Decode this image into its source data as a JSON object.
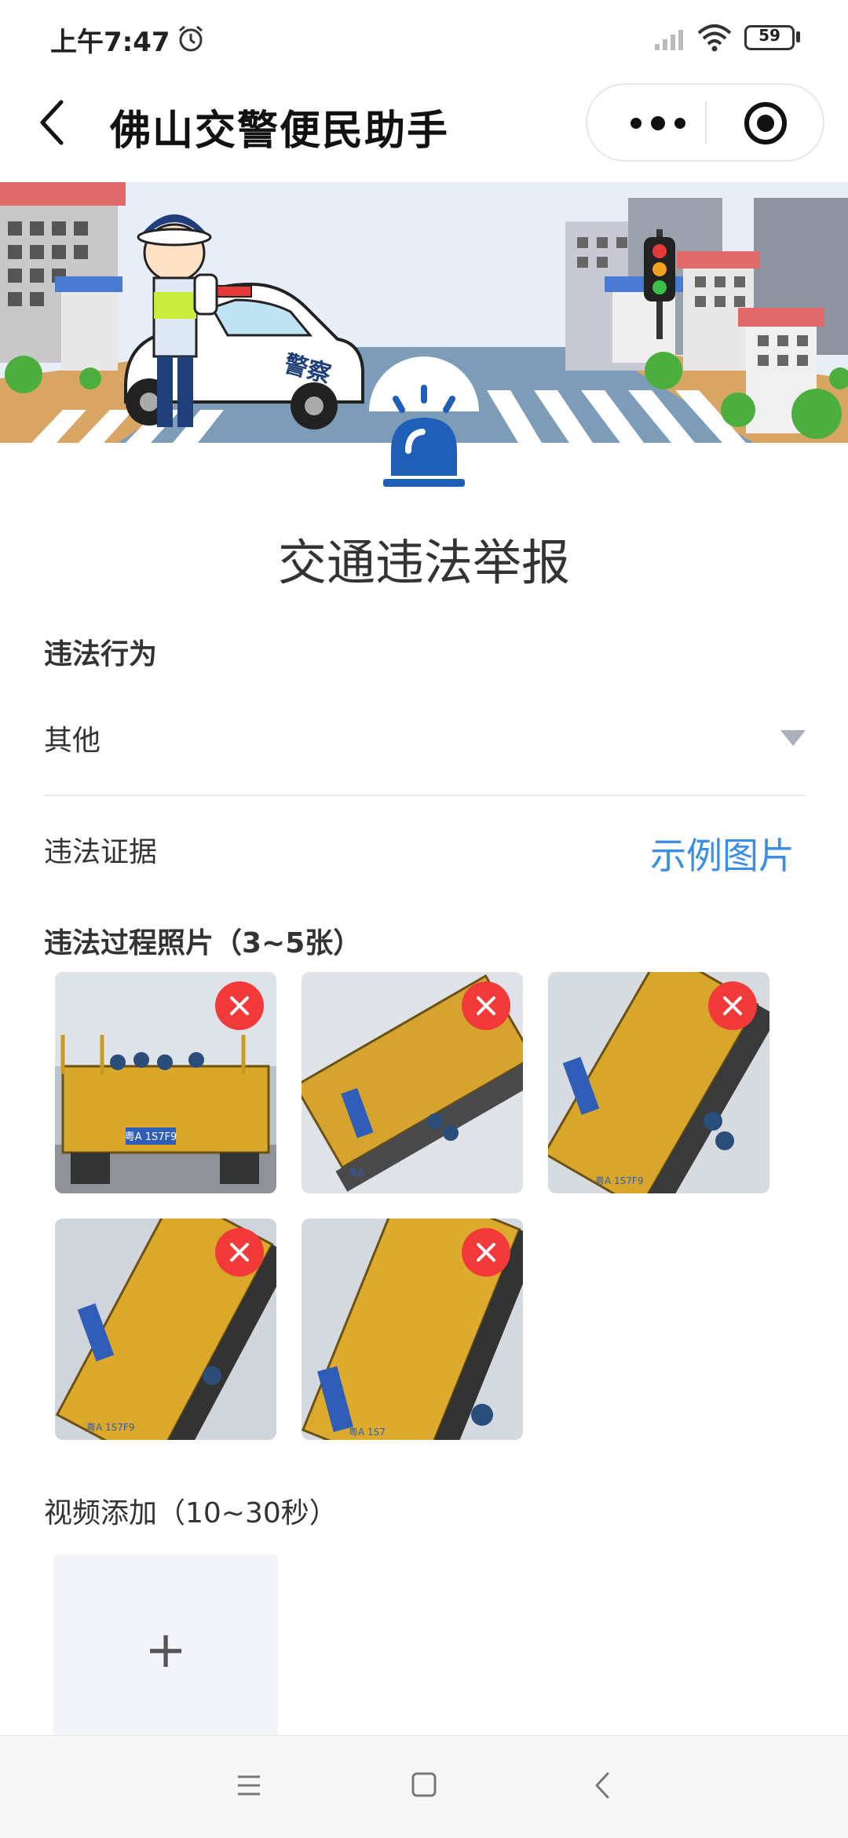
{
  "status_bar": {
    "time": "上午7:47",
    "battery": "59"
  },
  "nav": {
    "title": "佛山交警便民助手",
    "back_icon": "chevron-left-icon",
    "more_icon": "more-dots-icon",
    "close_icon": "target-circle-icon"
  },
  "banner": {
    "car_text": "警察"
  },
  "page": {
    "title": "交通违法举报"
  },
  "form": {
    "violation_label": "违法行为",
    "violation_value": "其他",
    "evidence_label": "违法证据",
    "example_link": "示例图片",
    "photos_label": "违法过程照片（3~5张）",
    "photos": [
      {
        "plate": "粤A 1S7F9"
      },
      {
        "plate": "粤A"
      },
      {
        "plate": "粤A 1S7F9"
      },
      {
        "plate": "粤A 1S7F9"
      },
      {
        "plate": "粤A 1S7"
      }
    ],
    "video_label": "视频添加（10~30秒）",
    "add_symbol": "+"
  },
  "colors": {
    "accent": "#3a8ee6",
    "delete": "#f23a3a",
    "siren": "#1f5fb8"
  }
}
